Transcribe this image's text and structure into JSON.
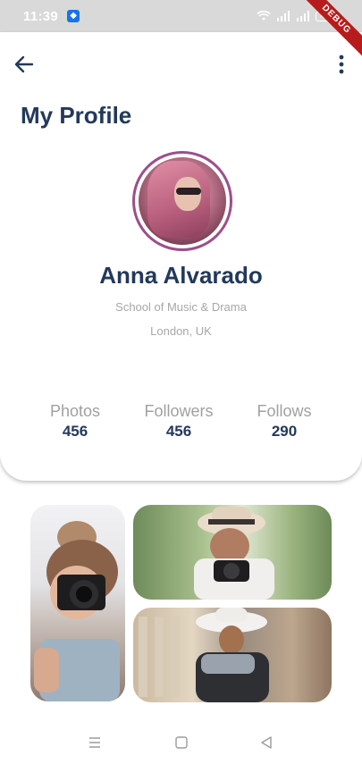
{
  "status_bar": {
    "time": "11:39",
    "battery": "40"
  },
  "debug_banner": "DEBUG",
  "page": {
    "title": "My Profile"
  },
  "profile": {
    "name": "Anna Alvarado",
    "school": "School of Music & Drama",
    "location": "London, UK"
  },
  "stats": [
    {
      "label": "Photos",
      "value": "456"
    },
    {
      "label": "Followers",
      "value": "456"
    },
    {
      "label": "Follows",
      "value": "290"
    }
  ],
  "colors": {
    "title": "#23395b",
    "avatar_ring": "#9c4f8a",
    "muted_text": "#a7a7a7"
  },
  "icons": {
    "back": "arrow-left-icon",
    "more": "more-vertical-icon",
    "nav_menu": "menu-icon",
    "nav_home": "home-square-icon",
    "nav_back": "back-triangle-icon"
  }
}
